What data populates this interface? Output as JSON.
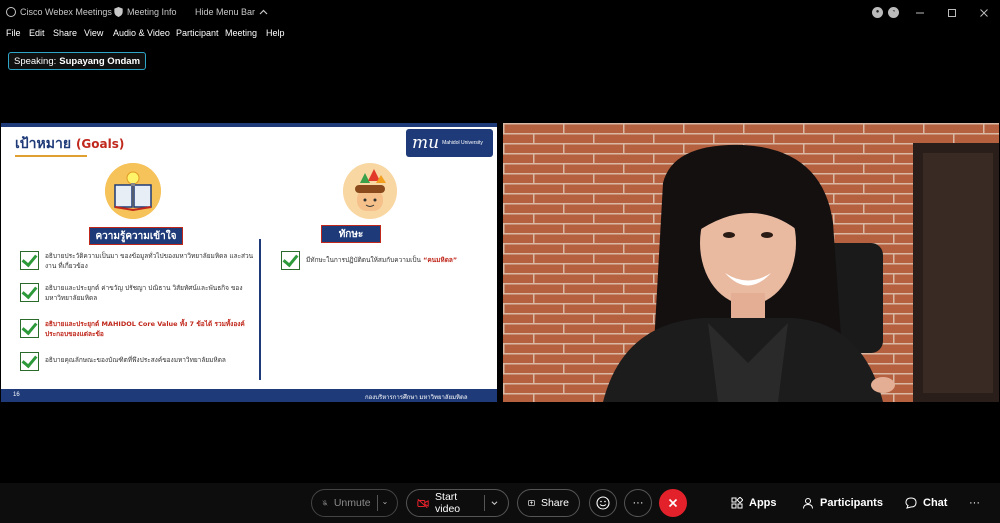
{
  "titlebar": {
    "app_name": "Cisco Webex Meetings",
    "meeting_info": "Meeting Info",
    "hide_menu": "Hide Menu Bar"
  },
  "menu": {
    "items": [
      "File",
      "Edit",
      "Share",
      "View",
      "Audio & Video",
      "Participant",
      "Meeting",
      "Help"
    ]
  },
  "speaking": {
    "label": "Speaking:",
    "name": "Supayang Ondam"
  },
  "slide": {
    "title": "เป้าหมาย",
    "title_en": "(Goals)",
    "logo_mark": "mu",
    "logo_text": "Mahidol University",
    "knowledge_header": "ความรู้ความเข้าใจ",
    "skill_header": "ทักษะ",
    "knowledge_items": [
      "อธิบายประวัติความเป็นมา ของข้อมูลทั่วไปของมหาวิทยาลัยมหิดล และส่วนงาน ที่เกี่ยวข้อง",
      "อธิบายและประยุกต์ ค่าขวัญ ปรัชญา ปณิธาน วิสัยทัศน์และพันธกิจ ของมหาวิทยาลัยมหิดล",
      "อธิบายและประยุกต์ MAHIDOL Core Value ทั้ง 7 ข้อได้ รวมทั้งองค์ประกอบของแต่ละข้อ",
      "อธิบายคุณลักษณะของบัณฑิตที่พึงประสงค์ของมหาวิทยาลัยมหิดล"
    ],
    "skill_item": "มีทักษะในการปฏิบัติตนให้สมกับความเป็น",
    "skill_highlight": "“คนมหิดล”",
    "page_number": "16",
    "footer_org": "กองบริหารการศึกษา    มหาวิทยาลัยมหิดล"
  },
  "toolbar": {
    "unmute": "Unmute",
    "start_video": "Start video",
    "share": "Share",
    "more": "···",
    "apps": "Apps",
    "participants": "Participants",
    "chat": "Chat",
    "overflow": "···"
  },
  "colors": {
    "accent": "#2ea6c9",
    "end_call": "#e3212b",
    "slide_navy": "#1e3a78",
    "slide_red": "#c0281c"
  }
}
